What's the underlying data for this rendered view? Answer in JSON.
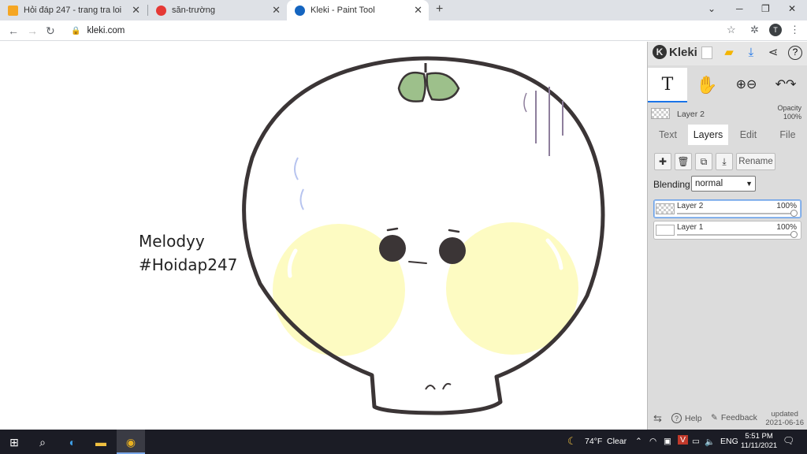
{
  "browser": {
    "tabs": [
      {
        "title": "Hỏi đáp 247 - trang tra loi",
        "favicon": "hoidap-favicon",
        "color": "#f5a623"
      },
      {
        "title": "săn-trường",
        "favicon": "santruong-favicon",
        "color": "#e53935"
      },
      {
        "title": "Kleki - Paint Tool",
        "favicon": "kleki-favicon",
        "color": "#1565c0"
      }
    ],
    "url": "kleki.com",
    "profile_initial": "T"
  },
  "canvas": {
    "signature_line1": "Melodyy",
    "signature_line2": "#Hoidap247",
    "outline_color": "#3b3536",
    "leaf_color": "#9dc08b",
    "cheek_color": "#fdfbc2"
  },
  "panel": {
    "logo": "Kleki",
    "tools": [
      "T",
      "✋",
      "zoom",
      "undo-redo"
    ],
    "current_layer": "Layer 2",
    "opacity_label": "Opacity",
    "opacity_value": "100%",
    "tabs": [
      "Text",
      "Layers",
      "Edit",
      "File"
    ],
    "active_tab": "Layers",
    "rename_label": "Rename",
    "blending_label": "Blending",
    "blending_value": "normal",
    "layers": [
      {
        "name": "Layer 2",
        "opacity": "100%",
        "opacity_fraction": 1.0,
        "selected": true
      },
      {
        "name": "Layer 1",
        "opacity": "100%",
        "opacity_fraction": 1.0,
        "selected": false
      }
    ],
    "help_label": "Help",
    "feedback_label": "Feedback",
    "updated_line1": "updated",
    "updated_line2": "2021-06-16"
  },
  "taskbar": {
    "weather_temp": "74°F",
    "weather_desc": "Clear",
    "language": "ENG",
    "time": "5:51 PM",
    "date": "11/11/2021"
  }
}
